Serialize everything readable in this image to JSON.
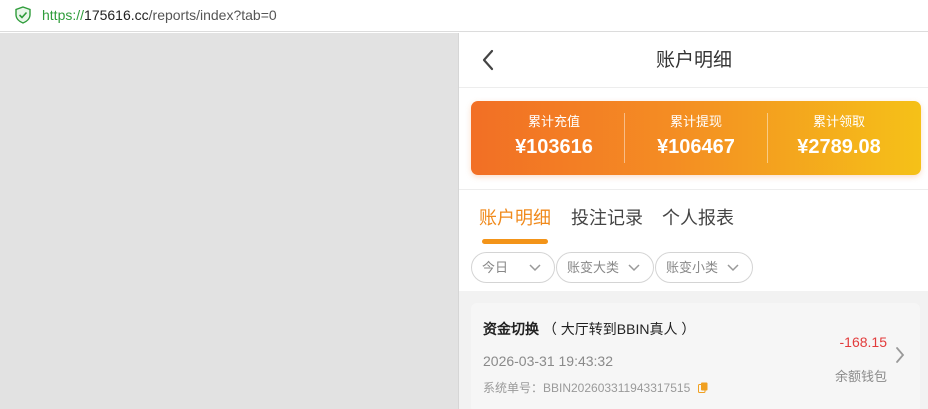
{
  "browser": {
    "url_scheme": "https://",
    "url_host": "175616.cc",
    "url_path": "/reports/index?tab=0"
  },
  "header": {
    "title": "账户明细"
  },
  "summary": {
    "items": [
      {
        "label": "累计充值",
        "value": "¥103616"
      },
      {
        "label": "累计提现",
        "value": "¥106467"
      },
      {
        "label": "累计领取",
        "value": "¥2789.08"
      }
    ]
  },
  "tabs": [
    {
      "label": "账户明细",
      "active": true
    },
    {
      "label": "投注记录",
      "active": false
    },
    {
      "label": "个人报表",
      "active": false
    }
  ],
  "filters": [
    {
      "value": "今日"
    },
    {
      "value": "账变大类"
    },
    {
      "value": "账变小类"
    }
  ],
  "records": [
    {
      "type": "资金切换",
      "detail": "（ 大厅转到BBIN真人 ）",
      "time": "2026-03-31 19:43:32",
      "order": "系统单号：BBIN202603311943317515",
      "amount": "-168.15",
      "wallet": "余额钱包"
    }
  ],
  "colors": {
    "accent": "#f08a1c",
    "negative": "#e23b3b",
    "gradient_start": "#f26f25",
    "gradient_end": "#f5c118"
  }
}
